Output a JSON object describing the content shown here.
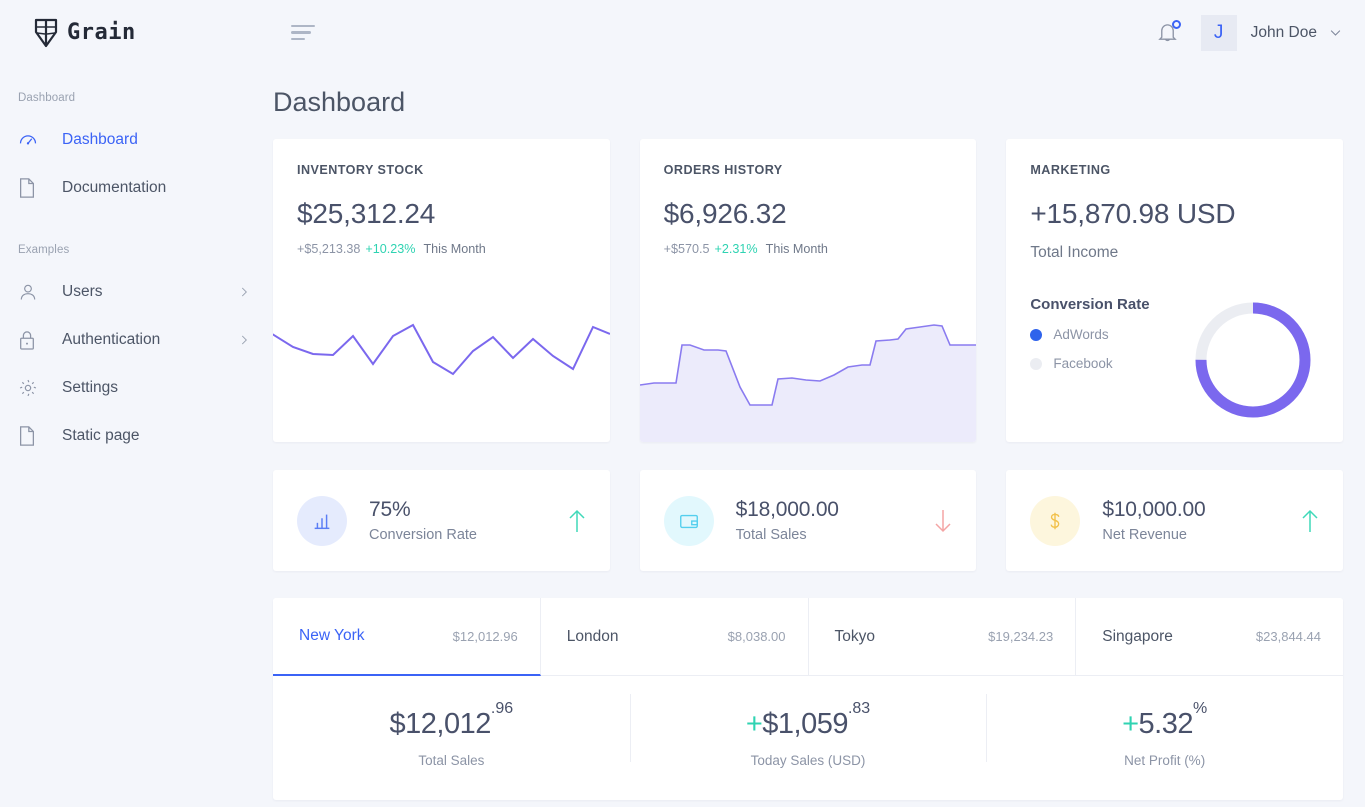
{
  "brand": {
    "name": "Grain",
    "logo_icon": "grain-shield-icon"
  },
  "sidebar": {
    "sections": [
      {
        "label": "Dashboard",
        "items": [
          {
            "label": "Dashboard",
            "icon": "gauge-icon",
            "active": true,
            "chevron": false
          },
          {
            "label": "Documentation",
            "icon": "document-icon",
            "active": false,
            "chevron": false
          }
        ]
      },
      {
        "label": "Examples",
        "items": [
          {
            "label": "Users",
            "icon": "user-icon",
            "active": false,
            "chevron": true
          },
          {
            "label": "Authentication",
            "icon": "lock-icon",
            "active": false,
            "chevron": true
          },
          {
            "label": "Settings",
            "icon": "gear-icon",
            "active": false,
            "chevron": false
          },
          {
            "label": "Static page",
            "icon": "document-icon",
            "active": false,
            "chevron": false
          }
        ]
      }
    ]
  },
  "topbar": {
    "menu_icon": "hamburger-icon",
    "notifications_icon": "bell-icon",
    "avatar_initial": "J",
    "user_name": "John Doe",
    "caret_icon": "chevron-down-icon"
  },
  "page": {
    "title": "Dashboard"
  },
  "cards": {
    "inventory": {
      "kicker": "INVENTORY STOCK",
      "value": "$25,312.24",
      "delta_abs": "+$5,213.38",
      "delta_pct": "+10.23%",
      "period": "This Month"
    },
    "orders": {
      "kicker": "ORDERS HISTORY",
      "value": "$6,926.32",
      "delta_abs": "+$570.5",
      "delta_pct": "+2.31%",
      "period": "This Month"
    },
    "marketing": {
      "kicker": "MARKETING",
      "value": "+15,870.98 USD",
      "subtitle": "Total Income",
      "conversion_title": "Conversion Rate",
      "legend": [
        {
          "label": "AdWords",
          "color": "#2f63ec"
        },
        {
          "label": "Facebook",
          "color": "#ebedf2"
        }
      ]
    }
  },
  "stats": [
    {
      "value": "75%",
      "label": "Conversion Rate",
      "icon": "bar-chart-icon",
      "icon_color": "#5a7df5",
      "icon_bg": "#e5ebfd",
      "trend": "up",
      "trend_color": "#3fd9b9"
    },
    {
      "value": "$18,000.00",
      "label": "Total Sales",
      "icon": "wallet-icon",
      "icon_color": "#54cfee",
      "icon_bg": "#e2f8fd",
      "trend": "down",
      "trend_color": "#f4a4a4"
    },
    {
      "value": "$10,000.00",
      "label": "Net Revenue",
      "icon": "dollar-icon",
      "icon_color": "#f2c14b",
      "icon_bg": "#fdf6dd",
      "trend": "up",
      "trend_color": "#3fd9b9"
    }
  ],
  "tabs": [
    {
      "name": "New York",
      "value": "$12,012.96",
      "active": true
    },
    {
      "name": "London",
      "value": "$8,038.00",
      "active": false
    },
    {
      "name": "Tokyo",
      "value": "$19,234.23",
      "active": false
    },
    {
      "name": "Singapore",
      "value": "$23,844.44",
      "active": false
    }
  ],
  "bottom_stats": [
    {
      "plus": "",
      "main": "$12,012",
      "sup": ".96",
      "label": "Total Sales"
    },
    {
      "plus": "+",
      "main": "$1,059",
      "sup": ".83",
      "label": "Today Sales (USD)"
    },
    {
      "plus": "+",
      "main": "5.32",
      "sup": "%",
      "label": "Net Profit (%)"
    }
  ],
  "chart_data": [
    {
      "type": "line",
      "title": "Inventory Stock sparkline",
      "series": [
        {
          "name": "Inventory Stock",
          "values": [
            62,
            52,
            45,
            44,
            58,
            34,
            58,
            72,
            38,
            28,
            48,
            60,
            40,
            56,
            42,
            30,
            70,
            64
          ]
        }
      ],
      "x": [
        0,
        1,
        2,
        3,
        4,
        5,
        6,
        7,
        8,
        9,
        10,
        11,
        12,
        13,
        14,
        15,
        16,
        17
      ],
      "color": "#7b68ee",
      "grid": false,
      "legend": "none",
      "ylim": [
        0,
        100
      ]
    },
    {
      "type": "area",
      "title": "Orders History sparkline",
      "series": [
        {
          "name": "Orders History",
          "values": [
            30,
            31,
            31,
            58,
            48,
            47,
            26,
            14,
            14,
            26,
            25,
            23,
            25,
            30,
            36,
            37,
            52,
            51,
            58,
            62,
            68,
            68,
            58,
            56
          ]
        }
      ],
      "x": [
        0,
        1,
        2,
        3,
        4,
        5,
        6,
        7,
        8,
        9,
        10,
        11,
        12,
        13,
        14,
        15,
        16,
        17,
        18,
        19,
        20,
        21,
        22,
        23
      ],
      "color": "#8a7bf0",
      "fill": "#eceafc",
      "grid": false,
      "legend": "none",
      "ylim": [
        0,
        100
      ]
    },
    {
      "type": "pie",
      "title": "Conversion Rate",
      "labels": [
        "AdWords",
        "Facebook"
      ],
      "values": [
        75,
        25
      ],
      "colors": [
        "#7b68ee",
        "#ebedf2"
      ],
      "donut": true,
      "legend": "left"
    }
  ]
}
